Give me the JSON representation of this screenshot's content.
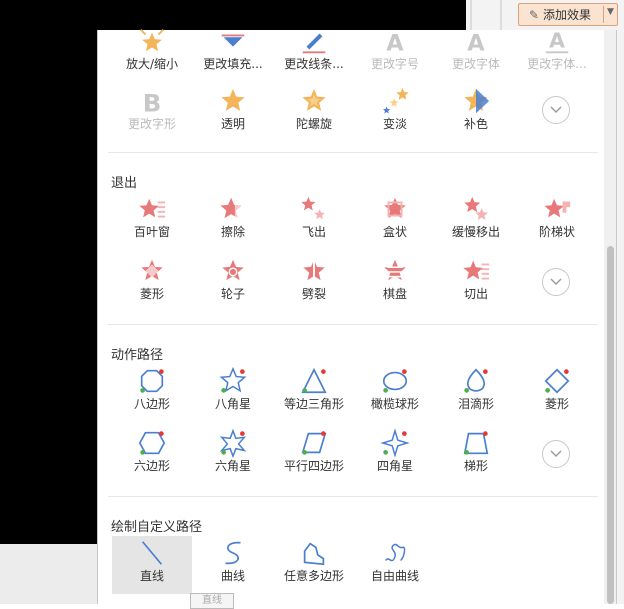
{
  "toolbar": {
    "add_effect_label": "添加效果",
    "add_effect_icon": "pen-icon"
  },
  "emphasis": {
    "items": [
      {
        "label": "放大/缩小",
        "icon": "star-burst-icon",
        "disabled": false
      },
      {
        "label": "更改填充...",
        "icon": "fill-bucket-icon",
        "disabled": false
      },
      {
        "label": "更改线条...",
        "icon": "pen-line-icon",
        "disabled": false
      },
      {
        "label": "更改字号",
        "icon": "letter-a-icon",
        "disabled": true
      },
      {
        "label": "更改字体",
        "icon": "letter-a-icon",
        "disabled": true
      },
      {
        "label": "更改字体...",
        "icon": "letter-a-underline-icon",
        "disabled": true
      },
      {
        "label": "更改字形",
        "icon": "letter-b-icon",
        "disabled": true
      },
      {
        "label": "透明",
        "icon": "star-icon",
        "disabled": false
      },
      {
        "label": "陀螺旋",
        "icon": "star-spin-icon",
        "disabled": false
      },
      {
        "label": "变淡",
        "icon": "stars-fade-icon",
        "disabled": false
      },
      {
        "label": "补色",
        "icon": "star-complement-icon",
        "disabled": false
      }
    ]
  },
  "exit": {
    "title": "退出",
    "items": [
      {
        "label": "百叶窗",
        "icon": "star-blinds-icon"
      },
      {
        "label": "擦除",
        "icon": "star-wipe-icon"
      },
      {
        "label": "飞出",
        "icon": "star-fly-icon"
      },
      {
        "label": "盒状",
        "icon": "star-box-icon"
      },
      {
        "label": "缓慢移出",
        "icon": "star-crawl-icon"
      },
      {
        "label": "阶梯状",
        "icon": "star-steps-icon"
      },
      {
        "label": "菱形",
        "icon": "star-diamond-icon"
      },
      {
        "label": "轮子",
        "icon": "star-wheel-icon"
      },
      {
        "label": "劈裂",
        "icon": "star-split-icon"
      },
      {
        "label": "棋盘",
        "icon": "star-checker-icon"
      },
      {
        "label": "切出",
        "icon": "star-cut-icon"
      }
    ]
  },
  "motion": {
    "title": "动作路径",
    "items": [
      {
        "label": "八边形",
        "icon": "octagon-path-icon"
      },
      {
        "label": "八角星",
        "icon": "eight-point-star-path-icon"
      },
      {
        "label": "等边三角形",
        "icon": "triangle-path-icon"
      },
      {
        "label": "橄榄球形",
        "icon": "football-path-icon"
      },
      {
        "label": "泪滴形",
        "icon": "teardrop-path-icon"
      },
      {
        "label": "菱形",
        "icon": "diamond-path-icon"
      },
      {
        "label": "六边形",
        "icon": "hexagon-path-icon"
      },
      {
        "label": "六角星",
        "icon": "six-point-star-path-icon"
      },
      {
        "label": "平行四边形",
        "icon": "parallelogram-path-icon"
      },
      {
        "label": "四角星",
        "icon": "four-point-star-path-icon"
      },
      {
        "label": "梯形",
        "icon": "trapezoid-path-icon"
      }
    ]
  },
  "custom": {
    "title": "绘制自定义路径",
    "items": [
      {
        "label": "直线",
        "icon": "line-path-icon"
      },
      {
        "label": "曲线",
        "icon": "curve-path-icon"
      },
      {
        "label": "任意多边形",
        "icon": "freeform-path-icon"
      },
      {
        "label": "自由曲线",
        "icon": "scribble-path-icon"
      }
    ]
  },
  "tooltip": {
    "text": "直线"
  },
  "more_icon": "chevron-down-icon"
}
